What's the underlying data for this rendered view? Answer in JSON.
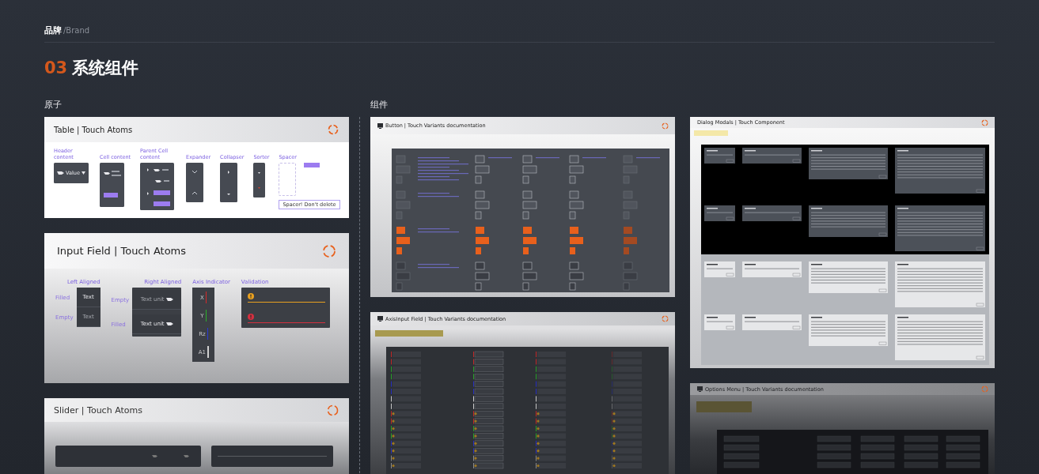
{
  "breadcrumb": {
    "title": "品牌",
    "subtitle": "/Brand"
  },
  "section": {
    "number": "03",
    "title": "系统组件"
  },
  "atoms": {
    "label": "原子",
    "cards": [
      {
        "kind": "table",
        "title": "Table | Touch Atoms",
        "groups": [
          {
            "label": "Header content",
            "kind": "header",
            "value": "Value"
          },
          {
            "label": "Cell content",
            "kind": "cell"
          },
          {
            "label": "Parent Cell content",
            "kind": "parent"
          },
          {
            "label": "Expander",
            "kind": "expander"
          },
          {
            "label": "Collapser",
            "kind": "collapser"
          },
          {
            "label": "Sorter",
            "kind": "sorter"
          },
          {
            "label": "Spacer",
            "kind": "spacer",
            "note": "Spacer! Don't delete"
          }
        ]
      },
      {
        "kind": "input",
        "title": "Input Field | Touch Atoms",
        "groups": [
          {
            "label": "Left Aligned",
            "kind": "fields",
            "rows": [
              {
                "label": "Filled",
                "value": "Text"
              },
              {
                "label": "Empty",
                "placeholder": "Text"
              }
            ]
          },
          {
            "label": "Right Aligned",
            "kind": "fields_unit",
            "rows": [
              {
                "label": "Empty",
                "placeholder": "Text unit"
              },
              {
                "label": "Filled",
                "value": "Text unit"
              }
            ]
          },
          {
            "label": "Axis Indicator",
            "kind": "axis",
            "axes": [
              {
                "name": "X",
                "color": "#d42a2a"
              },
              {
                "name": "Y",
                "color": "#2ab02a"
              },
              {
                "name": "Rz",
                "color": "#2a3ad4"
              },
              {
                "name": "A1",
                "color": "#d0d0d0"
              }
            ]
          },
          {
            "label": "Validation",
            "kind": "validation",
            "rows": [
              {
                "color": "#e8a020"
              },
              {
                "color": "#d43040"
              }
            ]
          }
        ]
      },
      {
        "kind": "slider",
        "title": "Slider | Touch Atoms"
      }
    ]
  },
  "components": {
    "label": "组件",
    "columns": [
      {
        "cards": [
          {
            "kind": "button_doc",
            "title": "Button | Touch Variants documentation"
          },
          {
            "kind": "axis_doc",
            "title": "AxisInput Field | Touch Variants documentation"
          }
        ]
      },
      {
        "cards": [
          {
            "kind": "dialog_doc",
            "title": "Dialog Modals | Touch Component"
          },
          {
            "kind": "options_doc",
            "title": "Options Menu | Touch Variants documentation"
          }
        ]
      }
    ]
  }
}
